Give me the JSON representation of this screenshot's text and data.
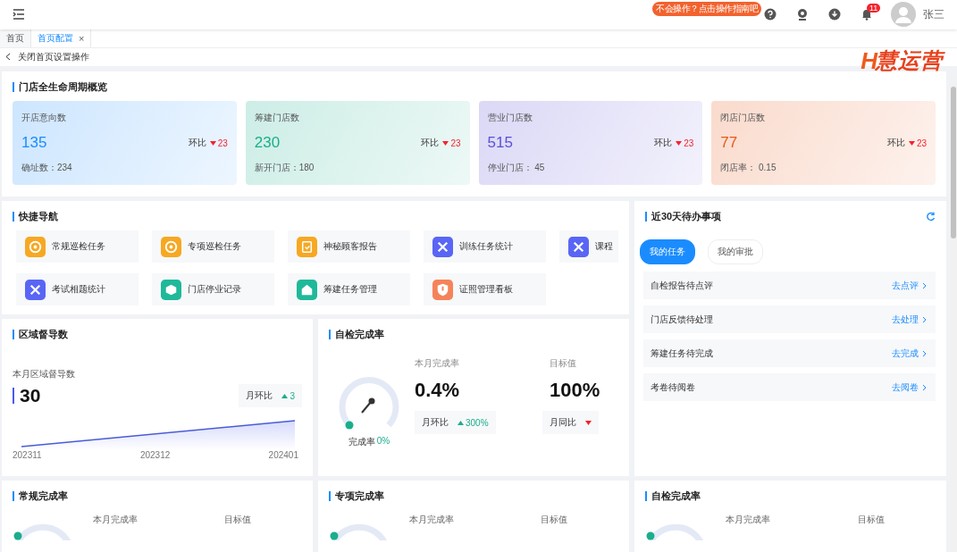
{
  "header": {
    "guide_badge": "不会操作？点击操作指南吧",
    "notification_count": "11",
    "user_name": "张三"
  },
  "tabs": [
    {
      "label": "首页",
      "selected": false,
      "closable": false
    },
    {
      "label": "首页配置",
      "selected": true,
      "closable": true
    }
  ],
  "close_tab_symbol": "×",
  "breadcrumb": "关闭首页设置操作",
  "logo": {
    "mark": "H",
    "name": "慧运营"
  },
  "overview": {
    "title": "门店全生命周期概览",
    "cards": [
      {
        "label": "开店意向数",
        "value": "135",
        "color": "#1a8cff",
        "trend_label": "环比",
        "trend_up": false,
        "trend_value": "23",
        "sub": "确址数：234"
      },
      {
        "label": "筹建门店数",
        "value": "230",
        "color": "#1aae8c",
        "trend_label": "环比",
        "trend_up": false,
        "trend_value": "23",
        "sub": "新开门店：180"
      },
      {
        "label": "营业门店数",
        "value": "515",
        "color": "#5b4fd6",
        "trend_label": "环比",
        "trend_up": false,
        "trend_value": "23",
        "sub": "停业门店：  45"
      },
      {
        "label": "闭店门店数",
        "value": "77",
        "color": "#e8591a",
        "trend_label": "环比",
        "trend_up": false,
        "trend_value": "23",
        "sub": "闭店率：  0.15"
      }
    ]
  },
  "quick_nav": {
    "title": "快捷导航",
    "items": [
      {
        "label": "常规巡检任务",
        "kind": "target",
        "color": "#f7a823"
      },
      {
        "label": "专项巡检任务",
        "kind": "target",
        "color": "#f7a823"
      },
      {
        "label": "神秘顾客报告",
        "kind": "clipboard",
        "color": "#f7a823"
      },
      {
        "label": "训练任务统计",
        "kind": "tools",
        "color": "#5966f5"
      },
      {
        "label": "课程",
        "kind": "tools",
        "color": "#5966f5"
      },
      {
        "label": "考试相题统计",
        "kind": "tools",
        "color": "#5966f5"
      },
      {
        "label": "门店停业记录",
        "kind": "cube",
        "color": "#1fb99a"
      },
      {
        "label": "筹建任务管理",
        "kind": "house",
        "color": "#1fb99a"
      },
      {
        "label": "证照管理看板",
        "kind": "shield",
        "color": "#f5835a"
      }
    ]
  },
  "todo": {
    "title": "近30天待办事项",
    "tabs": [
      {
        "label": "我的任务",
        "selected": true
      },
      {
        "label": "我的审批",
        "selected": false
      }
    ],
    "items": [
      {
        "label": "自检报告待点评",
        "action": "去点评"
      },
      {
        "label": "门店反馈待处理",
        "action": "去处理"
      },
      {
        "label": "筹建任务待完成",
        "action": "去完成"
      },
      {
        "label": "考卷待阅卷",
        "action": "去阅卷"
      }
    ]
  },
  "region": {
    "title": "区域督导数",
    "metric_label": "本月区域督导数",
    "value": "30",
    "compare_label": "月环比",
    "trend_up": true,
    "compare_value": "3",
    "x_labels": [
      "202311",
      "202312",
      "202401"
    ]
  },
  "self_check": {
    "title": "自检完成率",
    "gauge_label": "完成率",
    "gauge_value": "0%",
    "rate_label": "本月完成率",
    "rate": "0.4%",
    "target_label": "目标值",
    "target": "100%",
    "compares": [
      {
        "label": "月环比",
        "trend_up": true,
        "value": "300%"
      },
      {
        "label": "月同比",
        "trend_up": false
      }
    ]
  },
  "completion_panels": [
    {
      "title": "常规完成率",
      "rate_label": "本月完成率",
      "target_label": "目标值"
    },
    {
      "title": "专项完成率",
      "rate_label": "本月完成率",
      "target_label": "目标值"
    },
    {
      "title": "自检完成率",
      "rate_label": "本月完成率",
      "target_label": "目标值"
    }
  ]
}
